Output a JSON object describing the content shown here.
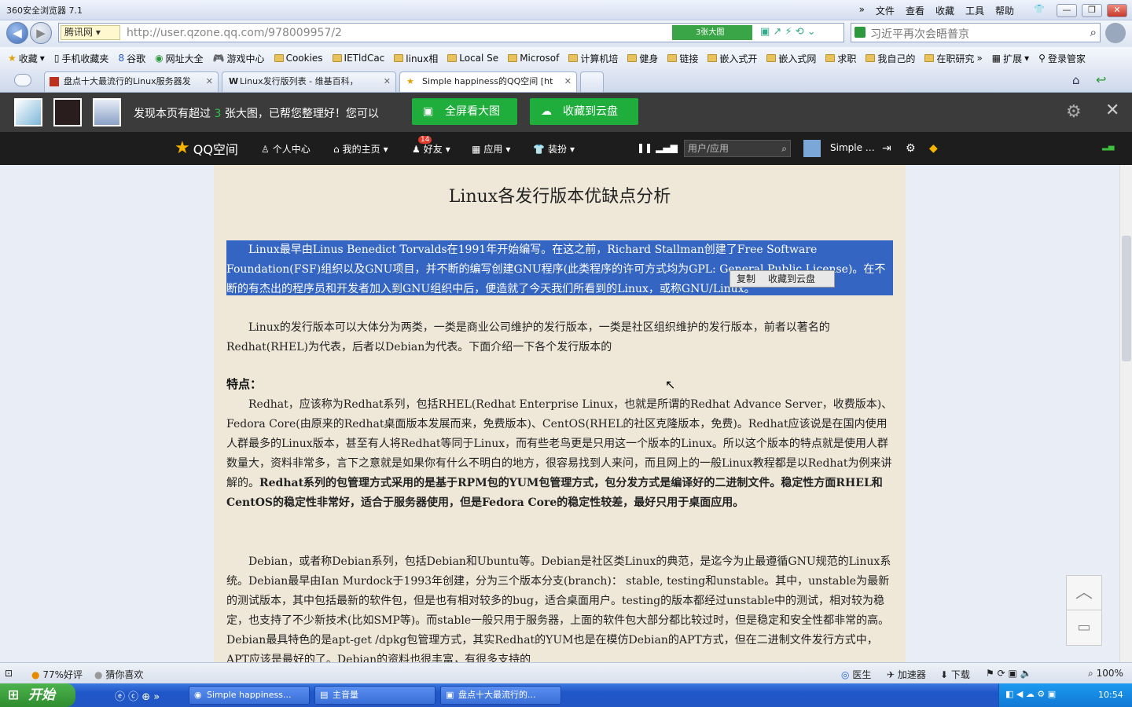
{
  "window": {
    "title": "360安全浏览器 7.1",
    "menu": [
      "文件",
      "查看",
      "收藏",
      "工具",
      "帮助"
    ]
  },
  "address": {
    "tag": "腾讯网",
    "url": "http://user.qzone.qq.com/978009957/2",
    "big_image_label": "3张大图",
    "search_text": "习近平再次会晤普京"
  },
  "bookmarks": [
    "收藏",
    "手机收藏夹",
    "谷歌",
    "网址大全",
    "游戏中心",
    "Cookies",
    "IETldCac",
    "linux相",
    "Local Se",
    "Microsof",
    "计算机培",
    "健身",
    "链接",
    "嵌入式开",
    "嵌入式网",
    "求职",
    "我自己的",
    "在职研究",
    "扩展",
    "登录管家"
  ],
  "tabs": [
    {
      "label": "盘点十大最流行的Linux服务器发"
    },
    {
      "label": "Linux发行版列表 - 维基百科，"
    },
    {
      "label": "Simple happiness的QQ空间 [ht"
    }
  ],
  "imagebar": {
    "message_pre": "发现本页有超过",
    "count": "3",
    "message_post": "张大图，已帮您整理好！您可以",
    "fullscreen_button": "全屏看大图",
    "cloud_button": "收藏到云盘"
  },
  "qzone": {
    "logo": "QQ空间",
    "nav": [
      "个人中心",
      "我的主页",
      "好友",
      "应用",
      "装扮"
    ],
    "friends_badge": "14",
    "search_placeholder": "用户/应用",
    "user": "Simple …"
  },
  "article": {
    "title": "Linux各发行版本优缺点分析",
    "p1": "Linux最早由Linus Benedict Torvalds在1991年开始编写。在这之前，Richard Stallman创建了Free Software Foundation(FSF)组织以及GNU项目，并不断的编写创建GNU程序(此类程序的许可方式均为GPL: General Public License)。在不断的有杰出的程序员和开发者加入到GNU组织中后，便造就了今天我们所看到的Linux，或称GNU/Linux。",
    "popup_copy": "复制",
    "popup_cloud": "收藏到云盘",
    "p2": "Linux的发行版本可以大体分为两类，一类是商业公司维护的发行版本，一类是社区组织维护的发行版本，前者以著名的Redhat(RHEL)为代表，后者以Debian为代表。下面介绍一下各个发行版本的",
    "features": "特点：",
    "p3": "Redhat，应该称为Redhat系列，包括RHEL(Redhat Enterprise Linux，也就是所谓的Redhat Advance Server，收费版本)、Fedora Core(由原来的Redhat桌面版本发展而来，免费版本)、CentOS(RHEL的社区克隆版本，免费)。Redhat应该说是在国内使用人群最多的Linux版本，甚至有人将Redhat等同于Linux，而有些老鸟更是只用这一个版本的Linux。所以这个版本的特点就是使用人群数量大，资料非常多，言下之意就是如果你有什么不明白的地方，很容易找到人来问，而且网上的一般Linux教程都是以Redhat为例来讲解的。",
    "p3_bold": "Redhat系列的包管理方式采用的是基于RPM包的YUM包管理方式，包分发方式是编译好的二进制文件。稳定性方面RHEL和CentOS的稳定性非常好，适合于服务器使用，但是Fedora Core的稳定性较差，最好只用于桌面应用。",
    "p4": "Debian，或者称Debian系列，包括Debian和Ubuntu等。Debian是社区类Linux的典范，是迄今为止最遵循GNU规范的Linux系统。Debian最早由Ian Murdock于1993年创建，分为三个版本分支(branch)： stable, testing和unstable。其中，unstable为最新的测试版本，其中包括最新的软件包，但是也有相对较多的bug，适合桌面用户。testing的版本都经过unstable中的测试，相对较为稳定，也支持了不少新技术(比如SMP等)。而stable一般只用于服务器，上面的软件包大部分都比较过时，但是稳定和安全性都非常的高。Debian最具特色的是apt-get /dpkg包管理方式，其实Redhat的YUM也是在模仿Debian的APT方式，但在二进制文件发行方式中，APT应该是最好的了。Debian的资料也很丰富，有很多支持的"
  },
  "status": {
    "rating": "77%好评",
    "guess": "猜你喜欢",
    "doctor": "医生",
    "accelerator": "加速器",
    "download": "下载",
    "zoom": "100%"
  },
  "taskbar": {
    "start": "开始",
    "tasks": [
      "Simple happiness...",
      "主音量",
      "盘点十大最流行的..."
    ],
    "clock": "10:54"
  }
}
